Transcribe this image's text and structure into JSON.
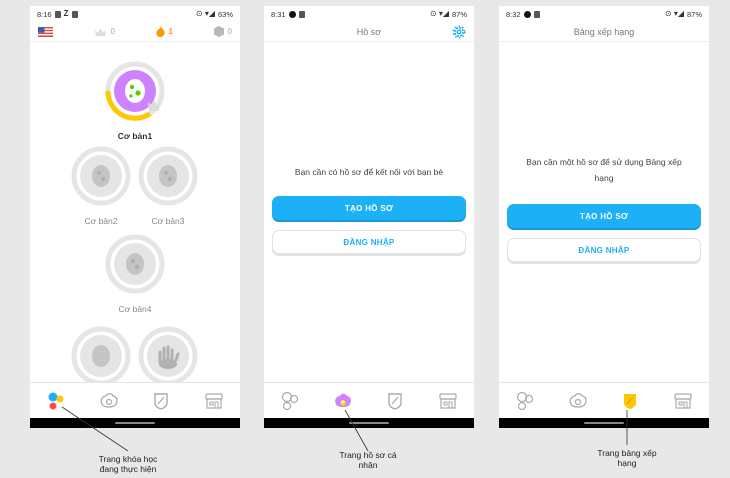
{
  "screens": [
    {
      "status_time": "8:16",
      "status_battery": "63%",
      "stats": {
        "crowns": "0",
        "streak": "1",
        "gems": "0"
      },
      "skills": [
        {
          "label": "Cơ bản1"
        },
        {
          "label": "Cơ bản2"
        },
        {
          "label": "Cơ bản3"
        },
        {
          "label": "Cơ bản4"
        }
      ],
      "caption": [
        "Trang khóa học",
        "đang thực hiện"
      ]
    },
    {
      "status_time": "8:31",
      "status_battery": "87%",
      "title": "Hồ sơ",
      "message": "Bạn cần có hồ sơ để kết nối với bạn bè",
      "primary_button": "TẠO HỒ SƠ",
      "secondary_button": "ĐĂNG NHẬP",
      "caption": [
        "Trang hồ sơ cá",
        "nhân"
      ]
    },
    {
      "status_time": "8:32",
      "status_battery": "87%",
      "title": "Bảng xếp hạng",
      "message_line1": "Bạn cần một hồ sơ để sử dụng Bảng xếp",
      "message_line2": "hạng",
      "primary_button": "TẠO HỒ SƠ",
      "secondary_button": "ĐĂNG NHẬP",
      "caption": [
        "Trang bảng xếp",
        "hạng"
      ]
    }
  ],
  "colors": {
    "primary": "#1cb0f6",
    "streak": "#ff9600",
    "egg_purple": "#ce82ff",
    "league_gold": "#ffc800",
    "gray_skill": "#e5e5e5"
  }
}
